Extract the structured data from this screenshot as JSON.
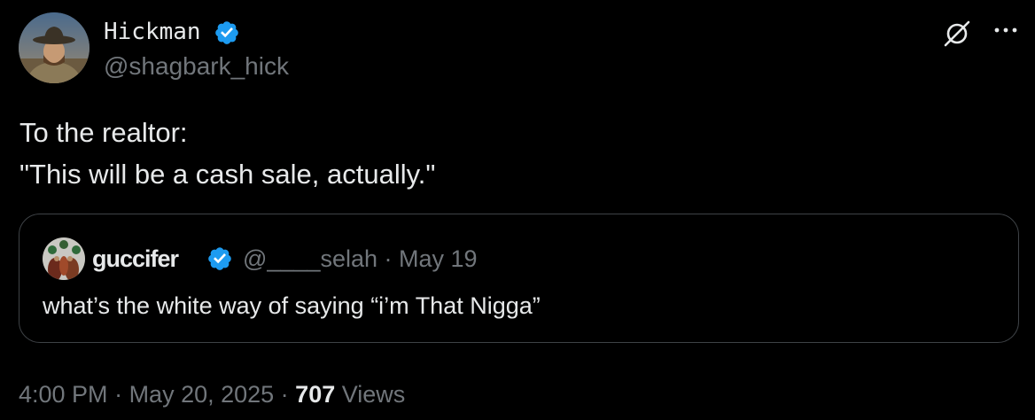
{
  "author": {
    "display_name": "Hickman",
    "handle": "@shagbark_hick",
    "verified": true
  },
  "tweet": {
    "lines": [
      "To the realtor:",
      "\"This will be a cash sale, actually.\""
    ]
  },
  "quoted_tweet": {
    "display_name": "guccifer",
    "handle_date": "@____selah · May 19",
    "verified": true,
    "text": "what’s the white way of saying “i’m That Nigga”"
  },
  "meta": {
    "time": "4:00 PM",
    "separator1": " · ",
    "date": "May 20, 2025",
    "separator2": " · ",
    "views_count": "707",
    "views_label": " Views"
  },
  "icons": {
    "verified": "verified-badge-icon",
    "grok": "grok-icon",
    "more": "more-options-icon"
  },
  "colors": {
    "background": "#000000",
    "text_primary": "#e7e9ea",
    "text_secondary": "#71767b",
    "verified_blue": "#1d9bf0",
    "border": "#3e4246"
  }
}
